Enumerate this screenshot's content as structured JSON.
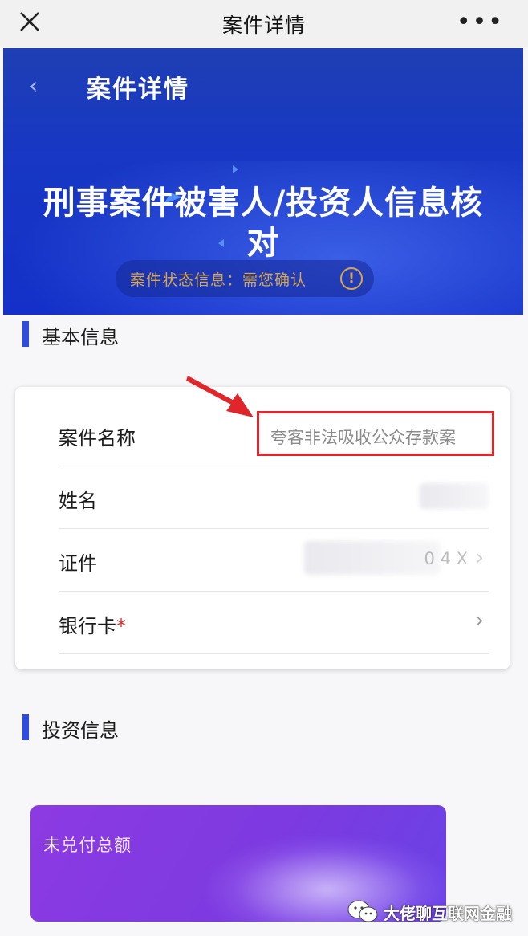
{
  "topbar": {
    "title": "案件详情",
    "more_label": "•••"
  },
  "banner": {
    "header_title": "案件详情",
    "main_title": "刑事案件被害人/投资人信息核对",
    "status_text": "案件状态信息：需您确认",
    "info_glyph": "!"
  },
  "basic_section": {
    "title": "基本信息",
    "rows": [
      {
        "label": "案件名称",
        "value": "夸客非法吸收公众存款案"
      },
      {
        "label": "姓名",
        "value": ""
      },
      {
        "label": "证件",
        "value": "0 4 X"
      },
      {
        "label": "银行卡",
        "required_mark": "*",
        "value": ""
      }
    ]
  },
  "invest_section": {
    "title": "投资信息",
    "card_label": "未兑付总额"
  },
  "watermark": {
    "text": "大佬聊互联网金融"
  },
  "colors": {
    "accent": "#2c4de0",
    "banner": "#1737c4",
    "status_gold": "#d7a64e",
    "highlight_red": "#e0262a",
    "purple": "#7c3ae0"
  }
}
